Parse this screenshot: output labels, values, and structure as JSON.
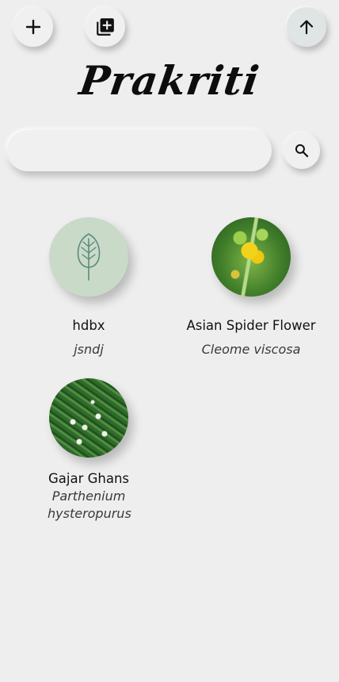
{
  "app": {
    "title": "Prakriti"
  },
  "toolbar": {
    "add_icon": "plus-icon",
    "library_icon": "library-add-icon",
    "up_icon": "arrow-up-icon"
  },
  "search": {
    "value": "",
    "icon": "search-icon"
  },
  "plants": [
    {
      "name": "hdbx",
      "scientific_name": "jsndj",
      "image": "leaf-placeholder"
    },
    {
      "name": "Asian Spider Flower",
      "scientific_name": "Cleome viscosa",
      "image": "yellow-flower-photo"
    },
    {
      "name": "Gajar Ghans",
      "scientific_name": "Parthenium hysteropurus",
      "image": "white-flower-weed-photo"
    }
  ],
  "colors": {
    "background": "#eeeeee",
    "placeholder_bg": "#c9dac8",
    "leaf_stroke": "#5d8a7e"
  }
}
